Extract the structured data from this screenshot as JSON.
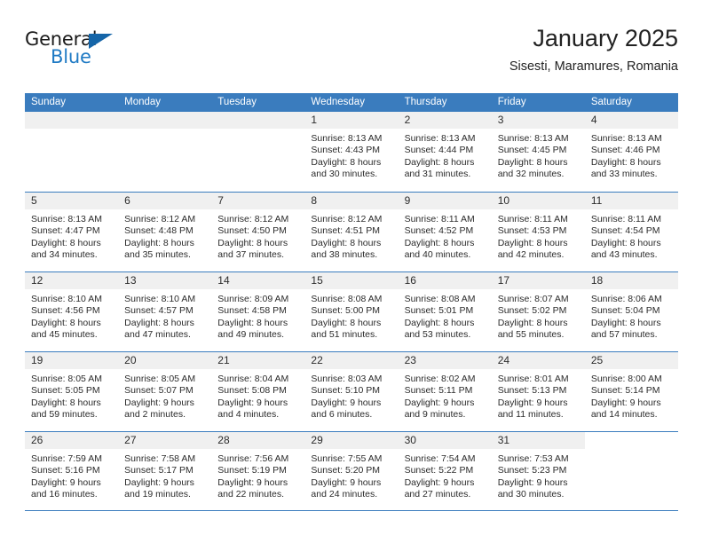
{
  "brand": {
    "general": "General",
    "blue": "Blue",
    "triangle_color": "#1565a8",
    "blue_color": "#1f7ac4"
  },
  "header": {
    "title": "January 2025",
    "subtitle": "Sisesti, Maramures, Romania"
  },
  "theme": {
    "header_blue": "#3a7cbe",
    "date_band_gray": "#f0f0f0",
    "text": "#2b2b2b"
  },
  "weekdays": [
    "Sunday",
    "Monday",
    "Tuesday",
    "Wednesday",
    "Thursday",
    "Friday",
    "Saturday"
  ],
  "weeks": [
    [
      {
        "day": "",
        "blank": false,
        "sunrise": "",
        "sunset": "",
        "daylight_line1": "",
        "daylight_line2": ""
      },
      {
        "day": "",
        "blank": false,
        "sunrise": "",
        "sunset": "",
        "daylight_line1": "",
        "daylight_line2": ""
      },
      {
        "day": "",
        "blank": false,
        "sunrise": "",
        "sunset": "",
        "daylight_line1": "",
        "daylight_line2": ""
      },
      {
        "day": "1",
        "blank": false,
        "sunrise": "Sunrise: 8:13 AM",
        "sunset": "Sunset: 4:43 PM",
        "daylight_line1": "Daylight: 8 hours",
        "daylight_line2": "and 30 minutes."
      },
      {
        "day": "2",
        "blank": false,
        "sunrise": "Sunrise: 8:13 AM",
        "sunset": "Sunset: 4:44 PM",
        "daylight_line1": "Daylight: 8 hours",
        "daylight_line2": "and 31 minutes."
      },
      {
        "day": "3",
        "blank": false,
        "sunrise": "Sunrise: 8:13 AM",
        "sunset": "Sunset: 4:45 PM",
        "daylight_line1": "Daylight: 8 hours",
        "daylight_line2": "and 32 minutes."
      },
      {
        "day": "4",
        "blank": false,
        "sunrise": "Sunrise: 8:13 AM",
        "sunset": "Sunset: 4:46 PM",
        "daylight_line1": "Daylight: 8 hours",
        "daylight_line2": "and 33 minutes."
      }
    ],
    [
      {
        "day": "5",
        "blank": false,
        "sunrise": "Sunrise: 8:13 AM",
        "sunset": "Sunset: 4:47 PM",
        "daylight_line1": "Daylight: 8 hours",
        "daylight_line2": "and 34 minutes."
      },
      {
        "day": "6",
        "blank": false,
        "sunrise": "Sunrise: 8:12 AM",
        "sunset": "Sunset: 4:48 PM",
        "daylight_line1": "Daylight: 8 hours",
        "daylight_line2": "and 35 minutes."
      },
      {
        "day": "7",
        "blank": false,
        "sunrise": "Sunrise: 8:12 AM",
        "sunset": "Sunset: 4:50 PM",
        "daylight_line1": "Daylight: 8 hours",
        "daylight_line2": "and 37 minutes."
      },
      {
        "day": "8",
        "blank": false,
        "sunrise": "Sunrise: 8:12 AM",
        "sunset": "Sunset: 4:51 PM",
        "daylight_line1": "Daylight: 8 hours",
        "daylight_line2": "and 38 minutes."
      },
      {
        "day": "9",
        "blank": false,
        "sunrise": "Sunrise: 8:11 AM",
        "sunset": "Sunset: 4:52 PM",
        "daylight_line1": "Daylight: 8 hours",
        "daylight_line2": "and 40 minutes."
      },
      {
        "day": "10",
        "blank": false,
        "sunrise": "Sunrise: 8:11 AM",
        "sunset": "Sunset: 4:53 PM",
        "daylight_line1": "Daylight: 8 hours",
        "daylight_line2": "and 42 minutes."
      },
      {
        "day": "11",
        "blank": false,
        "sunrise": "Sunrise: 8:11 AM",
        "sunset": "Sunset: 4:54 PM",
        "daylight_line1": "Daylight: 8 hours",
        "daylight_line2": "and 43 minutes."
      }
    ],
    [
      {
        "day": "12",
        "blank": false,
        "sunrise": "Sunrise: 8:10 AM",
        "sunset": "Sunset: 4:56 PM",
        "daylight_line1": "Daylight: 8 hours",
        "daylight_line2": "and 45 minutes."
      },
      {
        "day": "13",
        "blank": false,
        "sunrise": "Sunrise: 8:10 AM",
        "sunset": "Sunset: 4:57 PM",
        "daylight_line1": "Daylight: 8 hours",
        "daylight_line2": "and 47 minutes."
      },
      {
        "day": "14",
        "blank": false,
        "sunrise": "Sunrise: 8:09 AM",
        "sunset": "Sunset: 4:58 PM",
        "daylight_line1": "Daylight: 8 hours",
        "daylight_line2": "and 49 minutes."
      },
      {
        "day": "15",
        "blank": false,
        "sunrise": "Sunrise: 8:08 AM",
        "sunset": "Sunset: 5:00 PM",
        "daylight_line1": "Daylight: 8 hours",
        "daylight_line2": "and 51 minutes."
      },
      {
        "day": "16",
        "blank": false,
        "sunrise": "Sunrise: 8:08 AM",
        "sunset": "Sunset: 5:01 PM",
        "daylight_line1": "Daylight: 8 hours",
        "daylight_line2": "and 53 minutes."
      },
      {
        "day": "17",
        "blank": false,
        "sunrise": "Sunrise: 8:07 AM",
        "sunset": "Sunset: 5:02 PM",
        "daylight_line1": "Daylight: 8 hours",
        "daylight_line2": "and 55 minutes."
      },
      {
        "day": "18",
        "blank": false,
        "sunrise": "Sunrise: 8:06 AM",
        "sunset": "Sunset: 5:04 PM",
        "daylight_line1": "Daylight: 8 hours",
        "daylight_line2": "and 57 minutes."
      }
    ],
    [
      {
        "day": "19",
        "blank": false,
        "sunrise": "Sunrise: 8:05 AM",
        "sunset": "Sunset: 5:05 PM",
        "daylight_line1": "Daylight: 8 hours",
        "daylight_line2": "and 59 minutes."
      },
      {
        "day": "20",
        "blank": false,
        "sunrise": "Sunrise: 8:05 AM",
        "sunset": "Sunset: 5:07 PM",
        "daylight_line1": "Daylight: 9 hours",
        "daylight_line2": "and 2 minutes."
      },
      {
        "day": "21",
        "blank": false,
        "sunrise": "Sunrise: 8:04 AM",
        "sunset": "Sunset: 5:08 PM",
        "daylight_line1": "Daylight: 9 hours",
        "daylight_line2": "and 4 minutes."
      },
      {
        "day": "22",
        "blank": false,
        "sunrise": "Sunrise: 8:03 AM",
        "sunset": "Sunset: 5:10 PM",
        "daylight_line1": "Daylight: 9 hours",
        "daylight_line2": "and 6 minutes."
      },
      {
        "day": "23",
        "blank": false,
        "sunrise": "Sunrise: 8:02 AM",
        "sunset": "Sunset: 5:11 PM",
        "daylight_line1": "Daylight: 9 hours",
        "daylight_line2": "and 9 minutes."
      },
      {
        "day": "24",
        "blank": false,
        "sunrise": "Sunrise: 8:01 AM",
        "sunset": "Sunset: 5:13 PM",
        "daylight_line1": "Daylight: 9 hours",
        "daylight_line2": "and 11 minutes."
      },
      {
        "day": "25",
        "blank": false,
        "sunrise": "Sunrise: 8:00 AM",
        "sunset": "Sunset: 5:14 PM",
        "daylight_line1": "Daylight: 9 hours",
        "daylight_line2": "and 14 minutes."
      }
    ],
    [
      {
        "day": "26",
        "blank": false,
        "sunrise": "Sunrise: 7:59 AM",
        "sunset": "Sunset: 5:16 PM",
        "daylight_line1": "Daylight: 9 hours",
        "daylight_line2": "and 16 minutes."
      },
      {
        "day": "27",
        "blank": false,
        "sunrise": "Sunrise: 7:58 AM",
        "sunset": "Sunset: 5:17 PM",
        "daylight_line1": "Daylight: 9 hours",
        "daylight_line2": "and 19 minutes."
      },
      {
        "day": "28",
        "blank": false,
        "sunrise": "Sunrise: 7:56 AM",
        "sunset": "Sunset: 5:19 PM",
        "daylight_line1": "Daylight: 9 hours",
        "daylight_line2": "and 22 minutes."
      },
      {
        "day": "29",
        "blank": false,
        "sunrise": "Sunrise: 7:55 AM",
        "sunset": "Sunset: 5:20 PM",
        "daylight_line1": "Daylight: 9 hours",
        "daylight_line2": "and 24 minutes."
      },
      {
        "day": "30",
        "blank": false,
        "sunrise": "Sunrise: 7:54 AM",
        "sunset": "Sunset: 5:22 PM",
        "daylight_line1": "Daylight: 9 hours",
        "daylight_line2": "and 27 minutes."
      },
      {
        "day": "31",
        "blank": false,
        "sunrise": "Sunrise: 7:53 AM",
        "sunset": "Sunset: 5:23 PM",
        "daylight_line1": "Daylight: 9 hours",
        "daylight_line2": "and 30 minutes."
      },
      {
        "day": "",
        "blank": true,
        "sunrise": "",
        "sunset": "",
        "daylight_line1": "",
        "daylight_line2": ""
      }
    ]
  ]
}
